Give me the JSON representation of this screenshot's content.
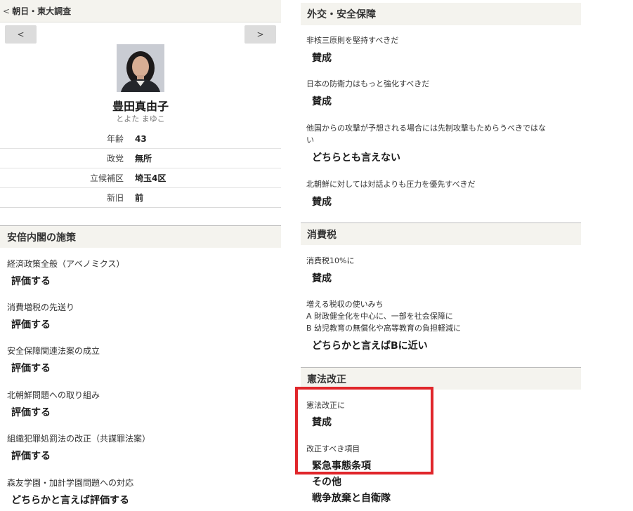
{
  "header": {
    "back_label": "朝日・東大調査",
    "prev_label": "<",
    "next_label": ">"
  },
  "candidate": {
    "name": "豊田真由子",
    "kana": "とよた まゆこ",
    "profile": [
      {
        "key": "年齢",
        "value": "43"
      },
      {
        "key": "政党",
        "value": "無所"
      },
      {
        "key": "立候補区",
        "value": "埼玉4区"
      },
      {
        "key": "新旧",
        "value": "前"
      }
    ]
  },
  "abe_policies": {
    "title": "安倍内閣の施策",
    "items": [
      {
        "question": "経済政策全般（アベノミクス）",
        "answer": "評価する"
      },
      {
        "question": "消費増税の先送り",
        "answer": "評価する"
      },
      {
        "question": "安全保障関連法案の成立",
        "answer": "評価する"
      },
      {
        "question": "北朝鮮問題への取り組み",
        "answer": "評価する"
      },
      {
        "question": "組織犯罪処罰法の改正（共謀罪法案）",
        "answer": "評価する"
      },
      {
        "question": "森友学園・加計学園問題への対応",
        "answer": "どちらかと言えば評価する"
      }
    ]
  },
  "diplomacy": {
    "title": "外交・安全保障",
    "items": [
      {
        "question": "非核三原則を堅持すべきだ",
        "answer": "賛成"
      },
      {
        "question": "日本の防衛力はもっと強化すべきだ",
        "answer": "賛成"
      },
      {
        "question_line1": "他国からの攻撃が予想される場合には先制攻撃もためらうべきではな",
        "question_line2": "い",
        "answer": "どちらとも言えない"
      },
      {
        "question": "北朝鮮に対しては対話よりも圧力を優先すべきだ",
        "answer": "賛成"
      }
    ]
  },
  "consumption_tax": {
    "title": "消費税",
    "items": [
      {
        "question": "消費税10%に",
        "answer": "賛成"
      },
      {
        "question": "増える税収の使いみち",
        "option_a": "A 財政健全化を中心に、一部を社会保障に",
        "option_b": "B 幼児教育の無償化や高等教育の負担軽減に",
        "answer": "どちらかと言えばBに近い"
      }
    ]
  },
  "constitution": {
    "title": "憲法改正",
    "items": [
      {
        "question": "憲法改正に",
        "answer": "賛成"
      },
      {
        "question": "改正すべき項目",
        "answers": [
          "緊急事態条項",
          "その他",
          "戦争放棄と自衛隊"
        ]
      }
    ]
  },
  "colors": {
    "header_bg": "#f4f3ee",
    "button_bg": "#dcdcdc",
    "highlight": "#e0262b"
  },
  "icons": {
    "back": "chevron-left-icon",
    "photo": "candidate-portrait"
  }
}
